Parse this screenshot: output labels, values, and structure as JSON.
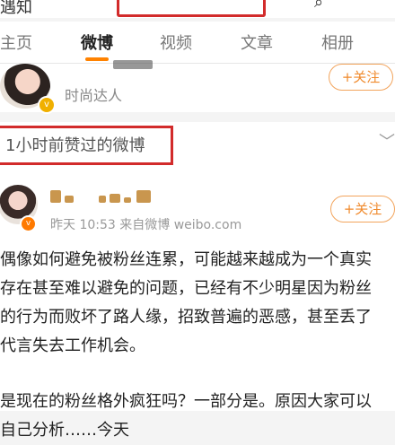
{
  "topbar": {
    "left_text": "遇知",
    "search_placeholder": "",
    "search_icon": "search-icon"
  },
  "tabs": [
    {
      "label": "主页",
      "active": false
    },
    {
      "label": "微博",
      "active": true
    },
    {
      "label": "视频",
      "active": false
    },
    {
      "label": "文章",
      "active": false
    },
    {
      "label": "相册",
      "active": false
    }
  ],
  "card1": {
    "subtitle": "时尚达人",
    "follow_label": "+关注",
    "badge": "v"
  },
  "section": {
    "title": "1小时前赞过的微博",
    "chevron": "﹀"
  },
  "post": {
    "meta": "昨天 10:53  来自微博 weibo.com",
    "follow_label": "+关注",
    "badge": "v",
    "lines": [
      "偶像如何避免被粉丝连累，可能越来越成为一个真实",
      "存在甚至难以避免的问题，已经有不少明星因为粉丝",
      "的行为而败坏了路人缘，招致普遍的恶感，甚至丢了",
      "代言失去工作机会。",
      "",
      "是现在的粉丝格外疯狂吗？一部分是。原因大家可以",
      "自己分析……今天"
    ]
  },
  "colors": {
    "accent": "#ff8200",
    "highlight_box": "#d22b2b",
    "follow": "#f08a2c"
  }
}
